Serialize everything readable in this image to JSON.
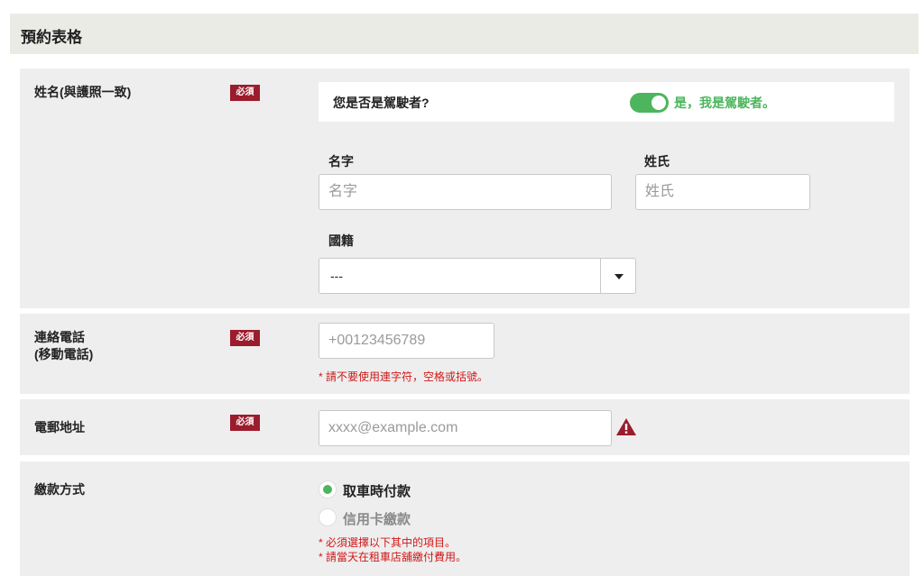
{
  "header": {
    "title": "預約表格"
  },
  "name_section": {
    "label": "姓名(與護照一致)",
    "required_badge": "必須",
    "driver_question": "您是否是駕駛者?",
    "driver_toggle_on": true,
    "driver_toggle_text": "是，我是駕駛者。",
    "first_name": {
      "label": "名字",
      "placeholder": "名字",
      "value": ""
    },
    "last_name": {
      "label": "姓氏",
      "placeholder": "姓氏",
      "value": ""
    },
    "nationality": {
      "label": "國籍",
      "selected": "---"
    }
  },
  "phone_section": {
    "label_line1": "連絡電話",
    "label_line2": "(移動電話)",
    "required_badge": "必須",
    "placeholder": "+00123456789",
    "note": "* 請不要使用連字符，空格或括號。"
  },
  "email_section": {
    "label": "電郵地址",
    "required_badge": "必須",
    "placeholder": "xxxx@example.com",
    "warning_icon": "warning-triangle-icon"
  },
  "payment_section": {
    "label": "繳款方式",
    "options": [
      {
        "label": "取車時付款",
        "selected": true
      },
      {
        "label": "信用卡繳款",
        "selected": false
      }
    ],
    "notes": [
      "* 必須選擇以下其中的項目。",
      "* 請當天在租車店舖繳付費用。"
    ]
  },
  "colors": {
    "accent_green": "#4cb55d",
    "required_red": "#9b1c2c",
    "note_red": "#d01818",
    "section_bg": "#eeeeee"
  }
}
